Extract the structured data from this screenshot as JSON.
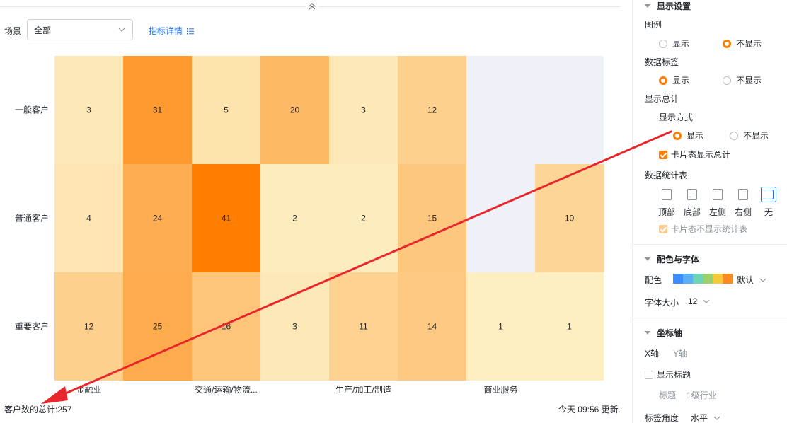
{
  "toolbar": {
    "scene_label": "场景",
    "scene_value": "全部",
    "metric_link": "指标详情"
  },
  "chart_data": {
    "type": "heatmap",
    "rows": [
      "一般客户",
      "普通客户",
      "重要客户"
    ],
    "columns": [
      "金融业",
      "",
      "交通/运输/物流...",
      "",
      "生产/加工/制造",
      "",
      "商业服务",
      ""
    ],
    "x_tick_labels": [
      "金融业",
      "交通/运输/物流...",
      "生产/加工/制造",
      "商业服务"
    ],
    "values": [
      [
        3,
        31,
        5,
        20,
        3,
        12,
        null,
        null
      ],
      [
        4,
        24,
        41,
        2,
        2,
        15,
        null,
        10
      ],
      [
        12,
        25,
        16,
        3,
        11,
        14,
        1,
        1
      ]
    ],
    "min": 1,
    "max": 41,
    "color_low": "#fdefc2",
    "color_high": "#ff7d00",
    "empty_color": "#eef1f8",
    "legend": "hidden",
    "grid": false
  },
  "footer": {
    "total": "客户数的总计:257",
    "updated": "今天 09:56 更新."
  },
  "panel": {
    "display_settings": "显示设置",
    "legend_label": "图例",
    "legend_show": "显示",
    "legend_hide": "不显示",
    "datalabel_label": "数据标签",
    "datalabel_show": "显示",
    "datalabel_hide": "不显示",
    "total_label": "显示总计",
    "total_mode_label": "显示方式",
    "total_show": "显示",
    "total_hide": "不显示",
    "card_total": "卡片态显示总计",
    "stats_table_label": "数据统计表",
    "positions": [
      "顶部",
      "底部",
      "左侧",
      "右侧",
      "无"
    ],
    "card_no_stats": "卡片态不显示统计表",
    "color_font": "配色与字体",
    "color_label": "配色",
    "color_value": "默认",
    "palette": [
      "#3b8cff",
      "#5bb0f5",
      "#6fd3b6",
      "#9bd16a",
      "#f5c938",
      "#ff8a1f"
    ],
    "font_size_label": "字体大小",
    "font_size_value": "12",
    "axis_label": "坐标轴",
    "x_axis": "X轴",
    "y_axis": "Y轴",
    "show_title": "显示标题",
    "title_label": "标题",
    "title_placeholder": "1级行业",
    "tick_angle_label": "标签角度",
    "tick_angle_value": "水平"
  }
}
